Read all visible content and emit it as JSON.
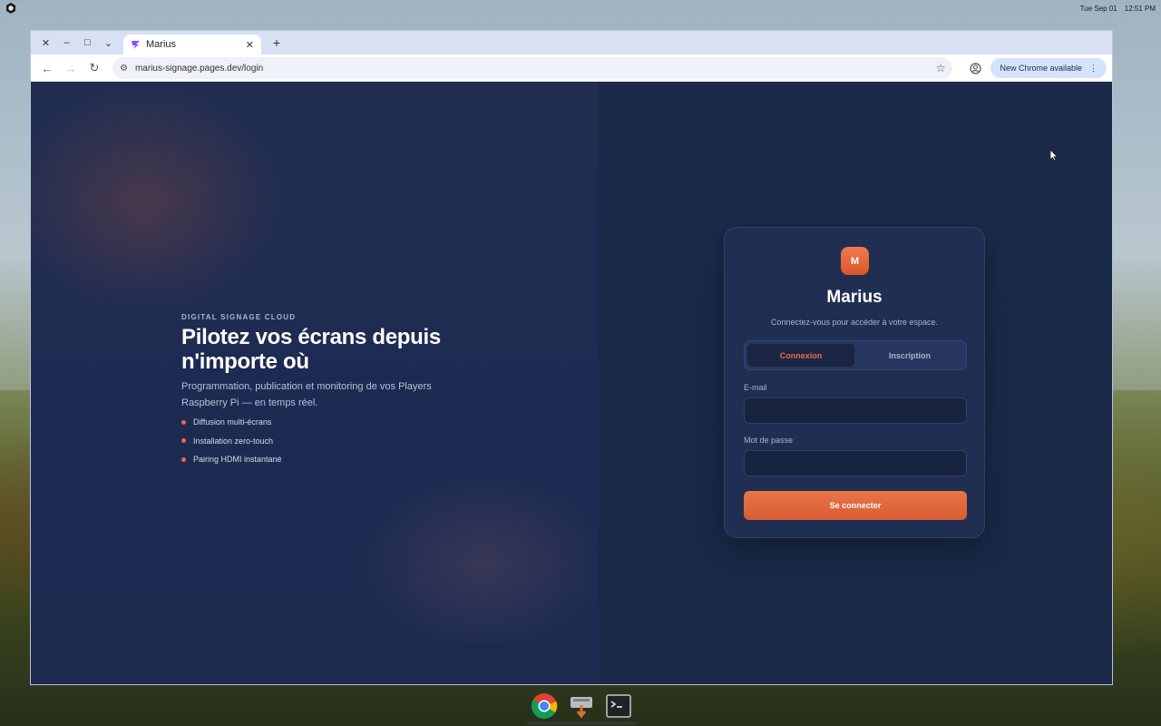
{
  "desktop": {
    "clock_date": "Tue Sep 01",
    "clock_time": "12:51 PM"
  },
  "browser": {
    "tab_title": "Marius",
    "url": "marius-signage.pages.dev/login",
    "update_label": "New Chrome available"
  },
  "hero": {
    "eyebrow": "DIGITAL SIGNAGE CLOUD",
    "headline": "Pilotez vos écrans depuis n'importe où",
    "lede": "Programmation, publication et monitoring de vos Players Raspberry Pi — en temps réel.",
    "features": [
      "Diffusion multi-écrans",
      "Installation zero-touch",
      "Pairing HDMI instantané"
    ]
  },
  "login": {
    "logo_letter": "M",
    "brand": "Marius",
    "subtitle": "Connectez-vous pour accéder à votre espace.",
    "tab_login": "Connexion",
    "tab_signup": "Inscription",
    "email_label": "E-mail",
    "email_value": "",
    "password_label": "Mot de passe",
    "password_value": "",
    "submit_label": "Se connecter"
  },
  "colors": {
    "accent": "#e8693f",
    "page_bg": "#1b2a4e",
    "card_bg": "#212f52"
  },
  "dock": {
    "items": [
      "chrome-icon",
      "installer-icon",
      "terminal-icon"
    ]
  }
}
